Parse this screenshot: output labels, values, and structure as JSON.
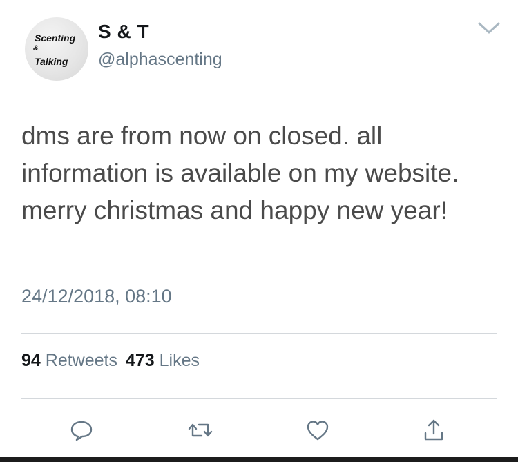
{
  "user": {
    "avatar_text": [
      "Scenting",
      "&",
      "Talking"
    ],
    "display_name": "S & T",
    "handle": "@alphascenting"
  },
  "tweet": {
    "text": "dms are from now on closed. all information is available on my website. merry christmas and happy new year!",
    "timestamp": "24/12/2018, 08:10"
  },
  "stats": {
    "retweets_count": "94",
    "retweets_label": "Retweets",
    "likes_count": "473",
    "likes_label": "Likes"
  },
  "icons": {
    "more": "chevron-down-icon",
    "reply": "reply-icon",
    "retweet": "retweet-icon",
    "like": "heart-icon",
    "share": "share-icon"
  },
  "colors": {
    "secondary_text": "#657786",
    "primary_text": "#14171a",
    "divider": "#d4d8dc"
  }
}
